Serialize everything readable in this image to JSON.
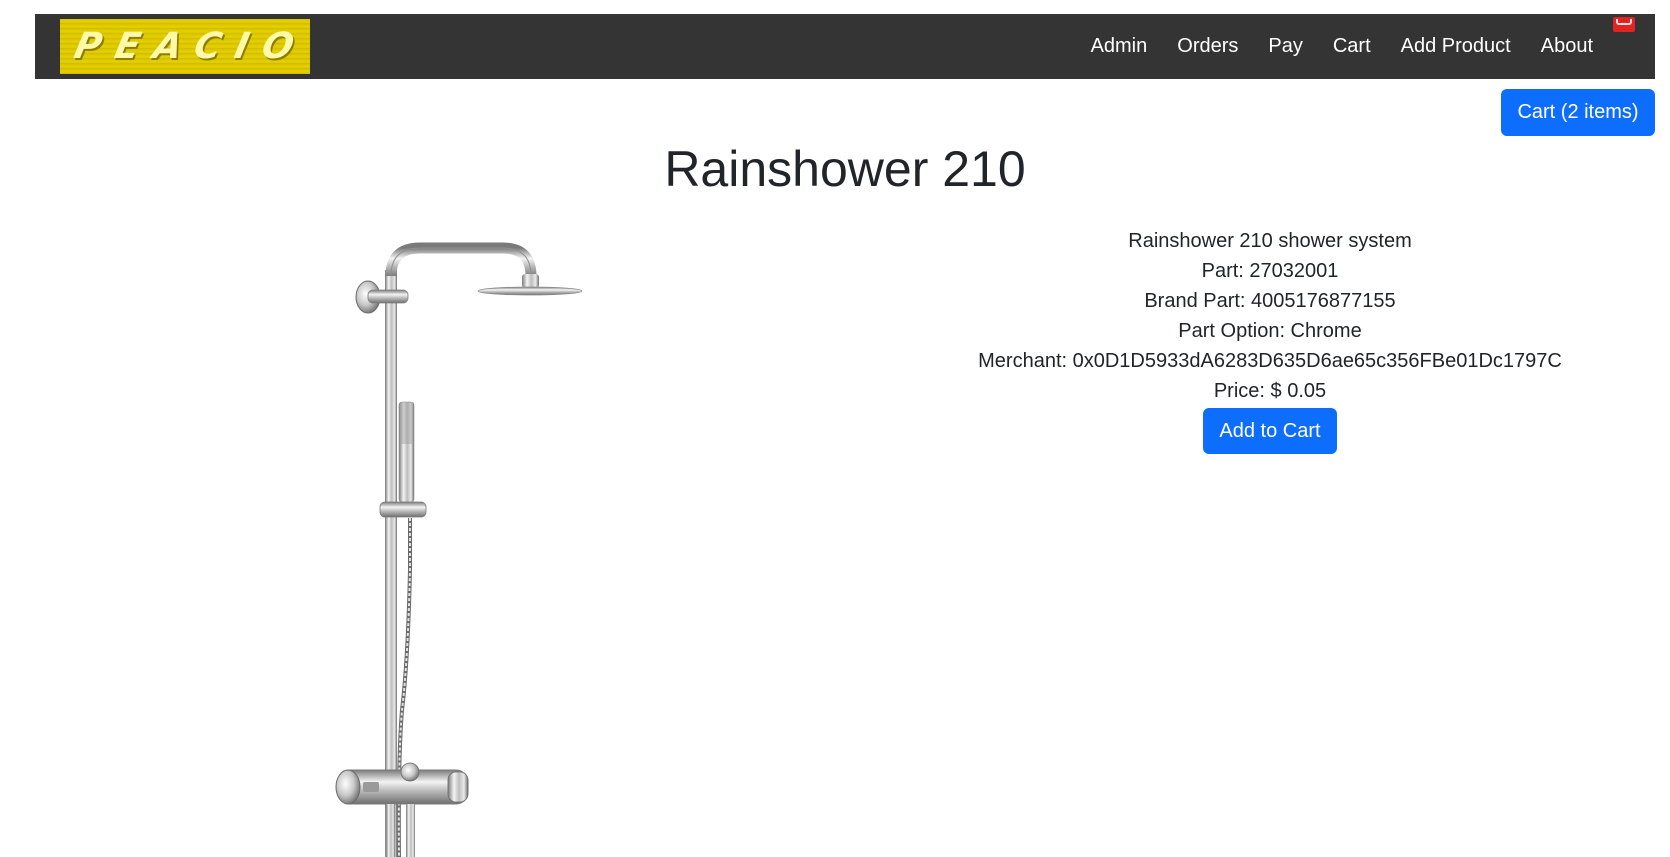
{
  "brand": {
    "logo_text": "PEACIO",
    "colors": {
      "logo_yellow": "#d8c400",
      "navbar_bg": "#343434",
      "primary": "#0d6efd",
      "mail_red": "#e02424"
    }
  },
  "nav": {
    "items": [
      {
        "label": "Admin"
      },
      {
        "label": "Orders"
      },
      {
        "label": "Pay"
      },
      {
        "label": "Cart"
      },
      {
        "label": "Add Product"
      },
      {
        "label": "About"
      }
    ],
    "mail_icon": "envelope-icon"
  },
  "cart_button": {
    "label": "Cart (2 items)"
  },
  "product": {
    "title": "Rainshower 210",
    "image_icon": "shower-system-image",
    "description": "Rainshower 210 shower system",
    "part": "Part: 27032001",
    "brand_part": "Brand Part: 4005176877155",
    "part_option": "Part Option: Chrome",
    "merchant": "Merchant: 0x0D1D5933dA6283D635D6ae65c356FBe01Dc1797C",
    "price": "Price: $ 0.05",
    "add_to_cart_label": "Add to Cart"
  }
}
